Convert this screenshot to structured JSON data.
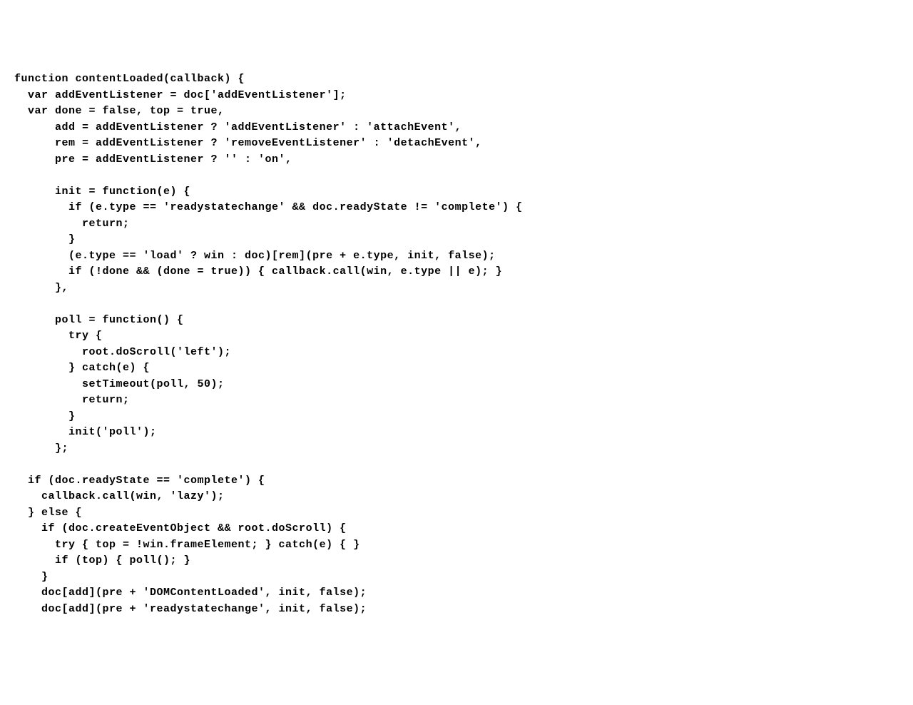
{
  "code": "function contentLoaded(callback) {\n  var addEventListener = doc['addEventListener'];\n  var done = false, top = true,\n      add = addEventListener ? 'addEventListener' : 'attachEvent',\n      rem = addEventListener ? 'removeEventListener' : 'detachEvent',\n      pre = addEventListener ? '' : 'on',\n\n      init = function(e) {\n        if (e.type == 'readystatechange' && doc.readyState != 'complete') {\n          return;\n        }\n        (e.type == 'load' ? win : doc)[rem](pre + e.type, init, false);\n        if (!done && (done = true)) { callback.call(win, e.type || e); }\n      },\n\n      poll = function() {\n        try {\n          root.doScroll('left');\n        } catch(e) {\n          setTimeout(poll, 50);\n          return;\n        }\n        init('poll');\n      };\n\n  if (doc.readyState == 'complete') {\n    callback.call(win, 'lazy');\n  } else {\n    if (doc.createEventObject && root.doScroll) {\n      try { top = !win.frameElement; } catch(e) { }\n      if (top) { poll(); }\n    }\n    doc[add](pre + 'DOMContentLoaded', init, false);\n    doc[add](pre + 'readystatechange', init, false);"
}
